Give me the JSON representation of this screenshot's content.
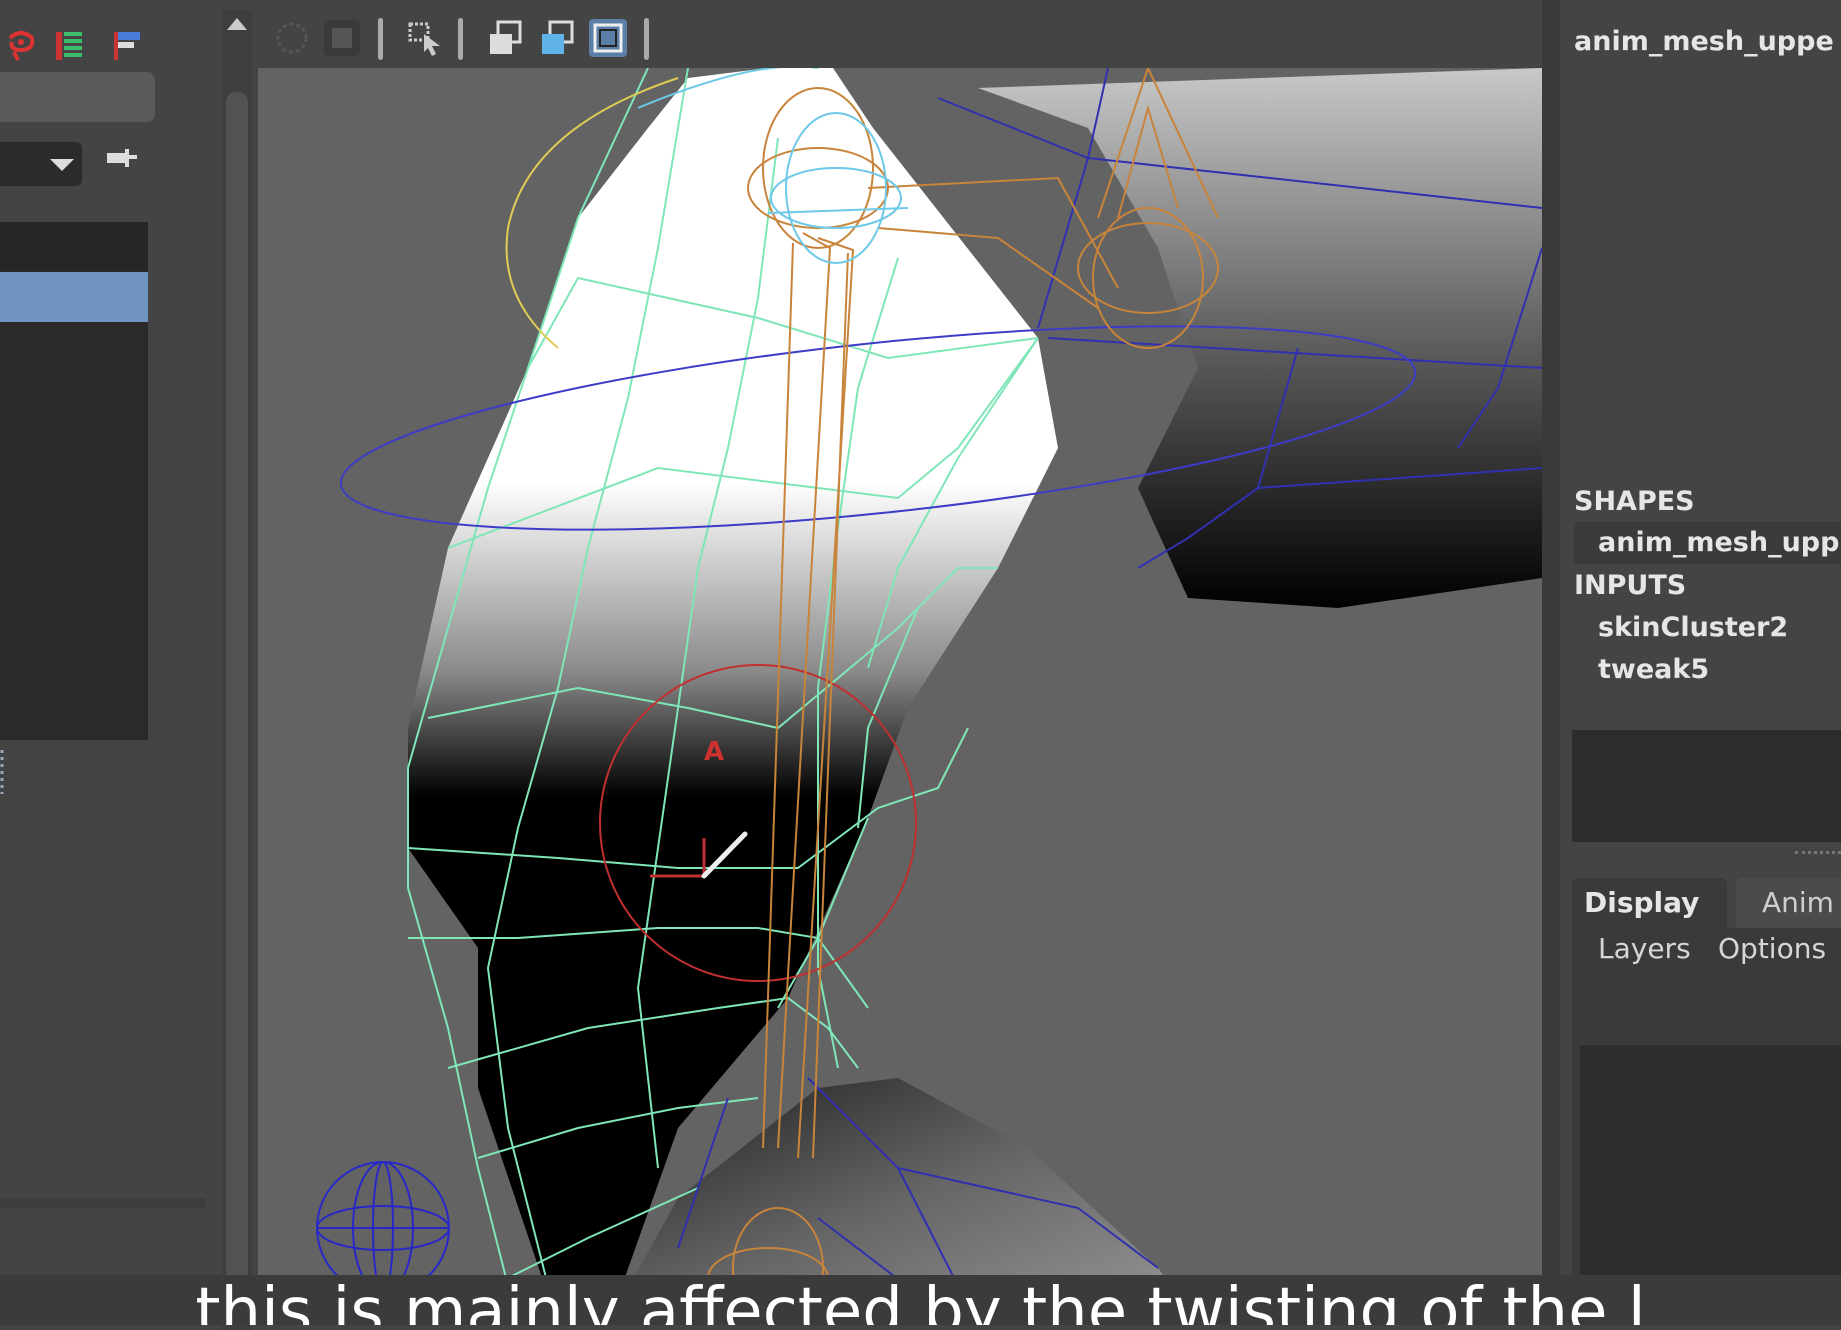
{
  "channel_box": {
    "object_name": "anim_mesh_uppe",
    "shapes_header": "SHAPES",
    "shape_name": "anim_mesh_upp",
    "inputs_header": "INPUTS",
    "inputs": [
      "skinCluster2",
      "tweak5"
    ]
  },
  "layer_editor": {
    "tabs": [
      "Display",
      "Anim"
    ],
    "menu": [
      "Layers",
      "Options"
    ]
  },
  "viewport": {
    "joint_label": "A"
  },
  "caption": {
    "text": "this is mainly affected by the twisting of the l"
  },
  "icons": {
    "left_toolbar": [
      "lasso-icon",
      "channel-list-icon",
      "flag-icon"
    ],
    "viewport_toolbar": [
      "select-circle-icon",
      "soft-select-icon",
      "select-cursor-icon",
      "isolate-icon",
      "duplicate-icon",
      "frame-selected-icon"
    ]
  },
  "colors": {
    "selection_highlight": "#6f94c2",
    "wireframe_mesh": "#7fe6b8",
    "joint_orange": "#c8843a",
    "control_blue": "#3c3cc8",
    "control_red": "#c03030",
    "control_yellow": "#e0cc55"
  }
}
